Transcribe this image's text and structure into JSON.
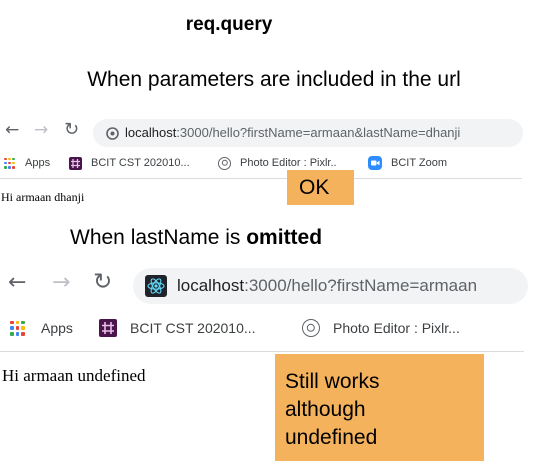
{
  "title": "req.query",
  "section1": {
    "heading": "When parameters are included in the url",
    "browser": {
      "back_glyph": "←",
      "forward_glyph": "→",
      "reload_glyph": "↻",
      "url_host": "localhost",
      "url_path": ":3000/hello?firstName=armaan&lastName=dhanji",
      "bookmarks": [
        {
          "label": "Apps",
          "icon": "apps-grid-icon"
        },
        {
          "label": "BCIT CST 202010...",
          "icon": "slack-icon"
        },
        {
          "label": "Photo Editor : Pixlr...",
          "icon": "aperture-icon"
        },
        {
          "label": "BCIT Zoom",
          "icon": "zoom-icon"
        }
      ],
      "page_text": "Hi armaan dhanji"
    },
    "note": "OK"
  },
  "section2": {
    "heading_prefix": "When lastName is ",
    "heading_bold": "omitted",
    "browser": {
      "back_glyph": "←",
      "forward_glyph": "→",
      "reload_glyph": "↻",
      "url_host": "localhost",
      "url_path": ":3000/hello?firstName=armaan",
      "bookmarks": [
        {
          "label": "Apps",
          "icon": "apps-grid-icon"
        },
        {
          "label": "BCIT CST 202010...",
          "icon": "slack-icon"
        },
        {
          "label": "Photo Editor : Pixlr...",
          "icon": "aperture-icon"
        }
      ],
      "page_text": "Hi armaan undefined"
    },
    "note_lines": [
      "Still works",
      "although",
      "undefined"
    ]
  },
  "colors": {
    "note_background": "#f4b25c",
    "zoom_blue": "#2d8cff",
    "slack_purple": "#4a154b",
    "react_dark": "#20232a",
    "react_cyan": "#61dafb"
  }
}
